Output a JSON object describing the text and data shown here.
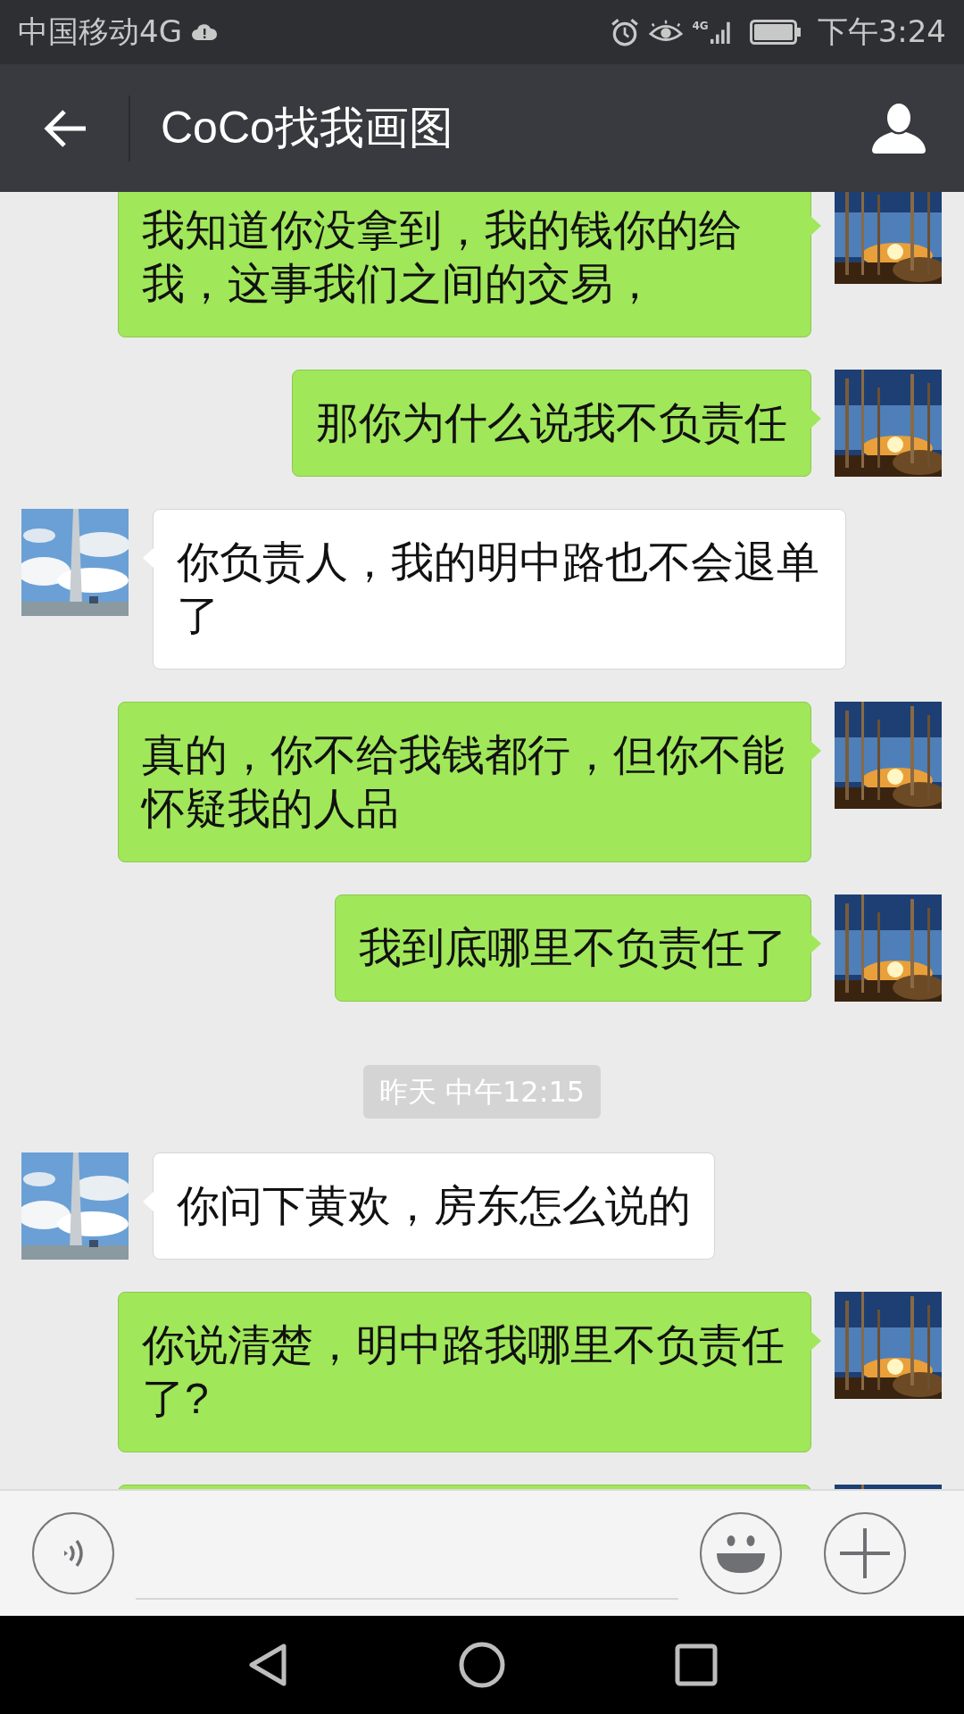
{
  "status_bar": {
    "carrier": "中国移动4G",
    "network_label": "4G",
    "time": "下午3:24"
  },
  "header": {
    "title": "CoCo找我画图"
  },
  "messages": [
    {
      "kind": "message",
      "outgoing": true,
      "text": "我知道你没拿到，我的钱你的给我，这事我们之间的交易，"
    },
    {
      "kind": "message",
      "outgoing": true,
      "text": "那你为什么说我不负责任"
    },
    {
      "kind": "message",
      "outgoing": false,
      "text": "你负责人，我的明中路也不会退单了"
    },
    {
      "kind": "message",
      "outgoing": true,
      "text": "真的，你不给我钱都行，但你不能怀疑我的人品"
    },
    {
      "kind": "message",
      "outgoing": true,
      "text": "我到底哪里不负责任了"
    },
    {
      "kind": "time",
      "text": "昨天 中午12:15"
    },
    {
      "kind": "message",
      "outgoing": false,
      "text": "你问下黄欢，房东怎么说的"
    },
    {
      "kind": "message",
      "outgoing": true,
      "text": "你说清楚，明中路我哪里不负责任了?"
    },
    {
      "kind": "message",
      "outgoing": true
    }
  ]
}
